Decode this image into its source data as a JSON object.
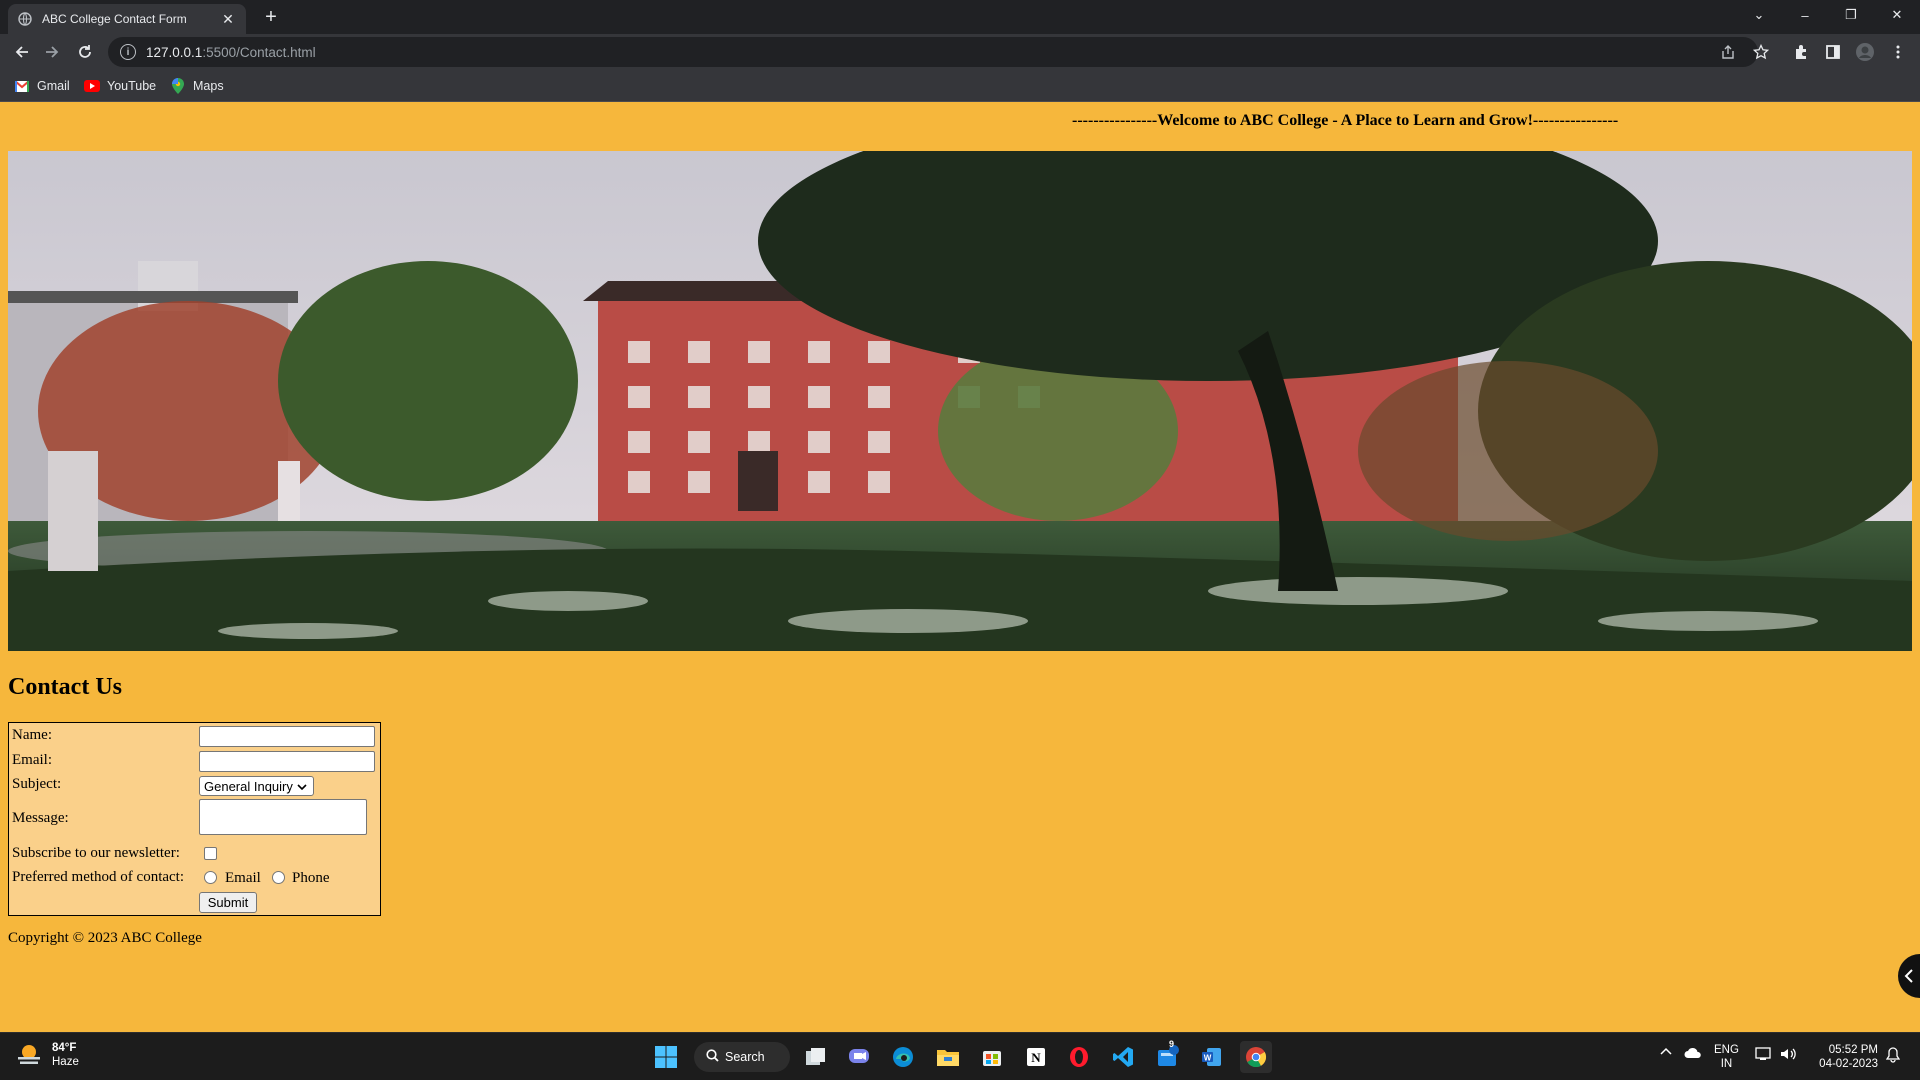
{
  "browser": {
    "tab_title": "ABC College Contact Form",
    "close_glyph": "✕",
    "newtab_glyph": "+",
    "url_host": "127.0.0.1",
    "url_path": ":5500/Contact.html",
    "window_controls": [
      "⌄",
      "–",
      "❐",
      "✕"
    ],
    "bookmarks": [
      {
        "label": "Gmail",
        "icon": "gmail-icon"
      },
      {
        "label": "YouTube",
        "icon": "youtube-icon"
      },
      {
        "label": "Maps",
        "icon": "maps-icon"
      }
    ]
  },
  "page": {
    "marquee": "----------------Welcome to ABC College - A Place to Learn and Grow!----------------",
    "contact_title": "Contact Us",
    "form": {
      "name_label": "Name:",
      "email_label": "Email:",
      "subject_label": "Subject:",
      "subject_value": "General Inquiry",
      "message_label": "Message:",
      "newsletter_label": "Subscribe to our newsletter:",
      "contact_method_label": "Preferred method of contact:",
      "radio_email": "Email",
      "radio_phone": "Phone",
      "submit": "Submit"
    },
    "copyright": "Copyright © 2023 ABC College"
  },
  "taskbar": {
    "temperature": "84°F",
    "condition": "Haze",
    "search": "Search",
    "lang_top": "ENG",
    "lang_bottom": "IN",
    "time": "05:52 PM",
    "date": "04-02-2023",
    "badge": "9"
  },
  "colors": {
    "page_bg": "#f6b73c",
    "form_bg": "#fad08a",
    "chrome_dark": "#202124",
    "chrome_mid": "#35363a"
  }
}
